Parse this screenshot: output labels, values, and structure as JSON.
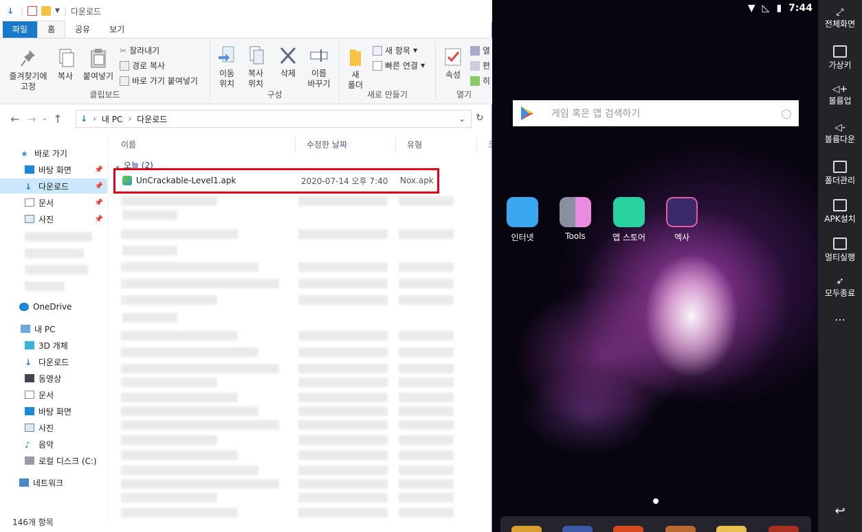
{
  "explorer": {
    "title": "다운로드",
    "tabs": [
      "파일",
      "홈",
      "공유",
      "보기"
    ],
    "ribbon": {
      "pin_label": "즐겨찾기에\n고정",
      "copy_label": "복사",
      "paste_label": "붙여넣기",
      "cut_label": "잘라내기",
      "copy_path_label": "경로 복사",
      "paste_shortcut_label": "바로 가기 붙여넣기",
      "clipboard_group": "클립보드",
      "move_to_label": "이동\n위치",
      "copy_to_label": "복사\n위치",
      "delete_label": "삭제",
      "rename_label": "이름\n바꾸기",
      "organize_group": "구성",
      "new_folder_label": "새\n폴더",
      "new_item_label": "새 항목",
      "easy_access_label": "빠른 연결",
      "new_group": "새로 만들기",
      "properties_label": "속성",
      "open_label": "열",
      "edit_label": "편",
      "history_label": "히",
      "open_group": "열기"
    },
    "address": {
      "pc": "내 PC",
      "folder": "다운로드"
    },
    "nav": {
      "quick_access": "바로 가기",
      "desktop": "바탕 화면",
      "downloads": "다운로드",
      "documents": "문서",
      "pictures": "사진",
      "onedrive": "OneDrive",
      "this_pc": "내 PC",
      "objects3d": "3D 개체",
      "pc_downloads": "다운로드",
      "videos": "동영상",
      "pc_documents": "문서",
      "pc_desktop": "바탕 화면",
      "pc_pictures": "사진",
      "music": "음악",
      "local_disk": "로컬 디스크 (C:)",
      "network": "네트워크"
    },
    "columns": {
      "name": "이름",
      "modified": "수정한 날짜",
      "type": "유형",
      "size": "크"
    },
    "group_today": "오늘 (2)",
    "file": {
      "name": "UnCrackable-Level1.apk",
      "modified": "2020-07-14 오후 7:40",
      "type": "Nox.apk"
    },
    "status": "146개 항목"
  },
  "emulator": {
    "time": "7:44",
    "search_placeholder": "게임 혹은 앱 검색하기",
    "apps": [
      {
        "label": "인터넷",
        "color": "#3aa8f0"
      },
      {
        "label": "Tools",
        "color": "#8a8fa0"
      },
      {
        "label": "앱 스토어",
        "color": "#28d3a0"
      },
      {
        "label": "엑사",
        "color": "#3a2a6a"
      }
    ]
  },
  "sidebar": {
    "fullscreen": "전체화면",
    "keyboard": "가상키",
    "vol_up": "볼륨업",
    "vol_down": "볼륨다운",
    "folder": "폴더관리",
    "apk": "APK설치",
    "multi": "멀티실행",
    "quit": "모두종료",
    "more": "⋯",
    "back": "↩"
  }
}
